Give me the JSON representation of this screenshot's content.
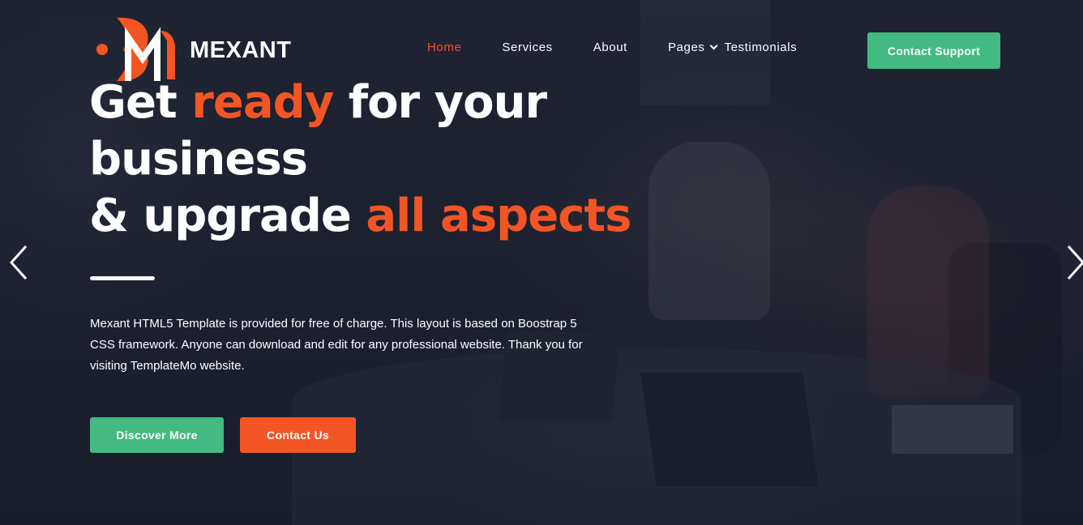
{
  "brand": {
    "name": "MEXANT",
    "primary_color": "#f35525",
    "secondary_color": "#43ba7f"
  },
  "nav": {
    "items": [
      {
        "label": "Home",
        "active": true
      },
      {
        "label": "Services",
        "active": false
      },
      {
        "label": "About",
        "active": false
      },
      {
        "label": "Pages",
        "active": false,
        "has_dropdown": true
      },
      {
        "label": "Testimonials",
        "active": false
      }
    ],
    "cta_label": "Contact Support"
  },
  "hero": {
    "headline": {
      "part1": "Get ",
      "accent1": "ready",
      "part2": " for your business",
      "part3": "& upgrade ",
      "accent2": "all aspects"
    },
    "description": "Mexant HTML5 Template is provided for free of charge. This layout is based on Boostrap 5 CSS framework. Anyone can download and edit for any professional website. Thank you for visiting TemplateMo website.",
    "buttons": {
      "discover": "Discover More",
      "contact": "Contact Us"
    },
    "slider_icons": {
      "prev": "chevron-left-icon",
      "next": "chevron-right-icon"
    }
  }
}
